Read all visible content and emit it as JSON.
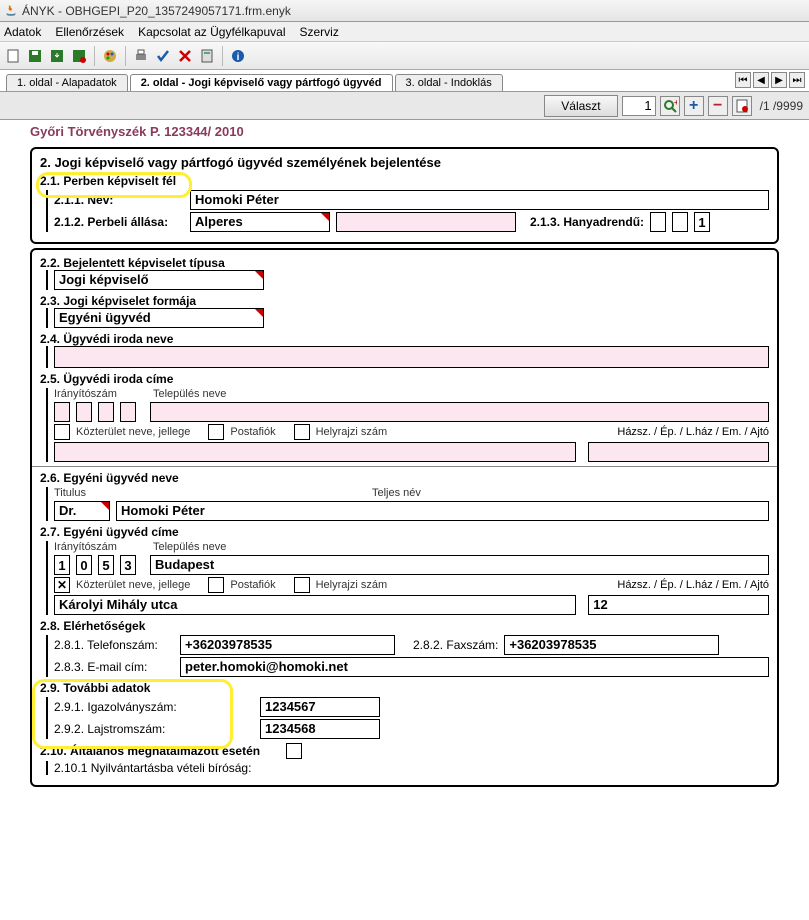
{
  "window": {
    "title": "ÁNYK - OBHGEPI_P20_1357249057171.frm.enyk"
  },
  "menu": {
    "items": [
      "Adatok",
      "Ellenőrzések",
      "Kapcsolat az Ügyfélkapuval",
      "Szerviz"
    ]
  },
  "tabs": {
    "items": [
      {
        "label": "1. oldal - Alapadatok"
      },
      {
        "label": "2. oldal - Jogi képviselő vagy pártfogó ügyvéd"
      },
      {
        "label": "3. oldal - Indoklás"
      }
    ]
  },
  "selector": {
    "button": "Választ",
    "current": "1",
    "total": "/1 /9999"
  },
  "header_strip": "Győri Törvényszék P. 123344/ 2010",
  "section2": {
    "title": "2. Jogi képviselő vagy pártfogó ügyvéd személyének bejelentése",
    "s21": {
      "label": "2.1. Perben képviselt fél"
    },
    "s211": {
      "label": "2.1.1. Név:",
      "value": "Homoki Péter"
    },
    "s212": {
      "label": "2.1.2. Perbeli állása:",
      "value": "Alperes"
    },
    "s213": {
      "label": "2.1.3. Hanyadrendű:",
      "value": "1"
    },
    "s22": {
      "label": "2.2. Bejelentett képviselet típusa",
      "value": "Jogi képviselő"
    },
    "s23": {
      "label": "2.3. Jogi képviselet formája",
      "value": "Egyéni ügyvéd"
    },
    "s24": {
      "label": "2.4. Ügyvédi iroda neve"
    },
    "s25": {
      "label": "2.5. Ügyvédi iroda címe",
      "iranyito": "Irányítószám",
      "telepules": "Település neve",
      "kozterulet": "Közterület neve, jellege",
      "postafiok": "Postafiók",
      "helyrajzi": "Helyrajzi szám",
      "hazsz": "Házsz. / Ép. / L.ház / Em. / Ajtó"
    },
    "s26": {
      "label": "2.6.  Egyéni ügyvéd neve",
      "titulus": "Titulus",
      "teljes": "Teljes név",
      "tit_val": "Dr.",
      "nev_val": "Homoki Péter"
    },
    "s27": {
      "label": "2.7.  Egyéni ügyvéd címe",
      "iranyito": "Irányítószám",
      "telepules": "Település neve",
      "ir_digits": [
        "1",
        "0",
        "5",
        "3"
      ],
      "telep_val": "Budapest",
      "kozterulet": "Közterület neve, jellege",
      "postafiok": "Postafiók",
      "helyrajzi": "Helyrajzi szám",
      "hazsz": "Házsz. / Ép. / L.ház / Em. / Ajtó",
      "koz_val": "Károlyi Mihály utca",
      "haz_val": "12"
    },
    "s28": {
      "label": "2.8. Elérhetőségek",
      "tel_l": "2.8.1. Telefonszám:",
      "tel_v": "+36203978535",
      "fax_l": "2.8.2. Faxszám:",
      "fax_v": "+36203978535",
      "email_l": "2.8.3. E-mail cím:",
      "email_v": "peter.homoki@homoki.net"
    },
    "s29": {
      "label": "2.9. További adatok",
      "igaz_l": "2.9.1. Igazolványszám:",
      "igaz_v": "1234567",
      "lajs_l": "2.9.2. Lajstromszám:",
      "lajs_v": "1234568"
    },
    "s210": {
      "label": "2.10. Általános megnatalmazott esetén"
    },
    "s2101": {
      "label": "2.10.1 Nyilvántartásba vételi bíróság:"
    }
  }
}
